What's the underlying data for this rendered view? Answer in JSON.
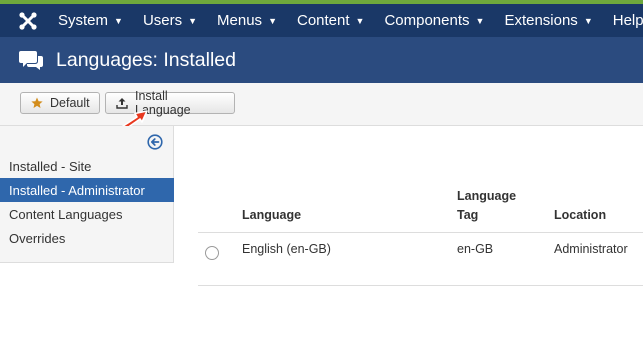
{
  "nav": {
    "items": [
      {
        "label": "System"
      },
      {
        "label": "Users"
      },
      {
        "label": "Menus"
      },
      {
        "label": "Content"
      },
      {
        "label": "Components"
      },
      {
        "label": "Extensions"
      },
      {
        "label": "Help"
      }
    ],
    "logo_icon": "joomla-icon",
    "caret_icon": "caret-down-icon"
  },
  "header": {
    "title": "Languages: Installed",
    "icon": "comments-icon"
  },
  "toolbar": {
    "default_label": "Default",
    "install_label": "Install Language",
    "default_icon": "star-icon",
    "install_icon": "upload-icon"
  },
  "sidebar": {
    "items": [
      {
        "label": "Installed - Site",
        "active": false
      },
      {
        "label": "Installed - Administrator",
        "active": true
      },
      {
        "label": "Content Languages",
        "active": false
      },
      {
        "label": "Overrides",
        "active": false
      }
    ],
    "collapse_icon": "arrow-circle-left-icon"
  },
  "table": {
    "columns": [
      "Language",
      "Language Tag",
      "Location"
    ],
    "rows": [
      {
        "language": "English (en-GB)",
        "tag": "en-GB",
        "location": "Administrator"
      }
    ]
  },
  "colors": {
    "navbar": "#1a3867",
    "titlebar": "#2b4b7f",
    "active_item": "#2f67ac",
    "annotation_arrow": "#e8381f"
  }
}
